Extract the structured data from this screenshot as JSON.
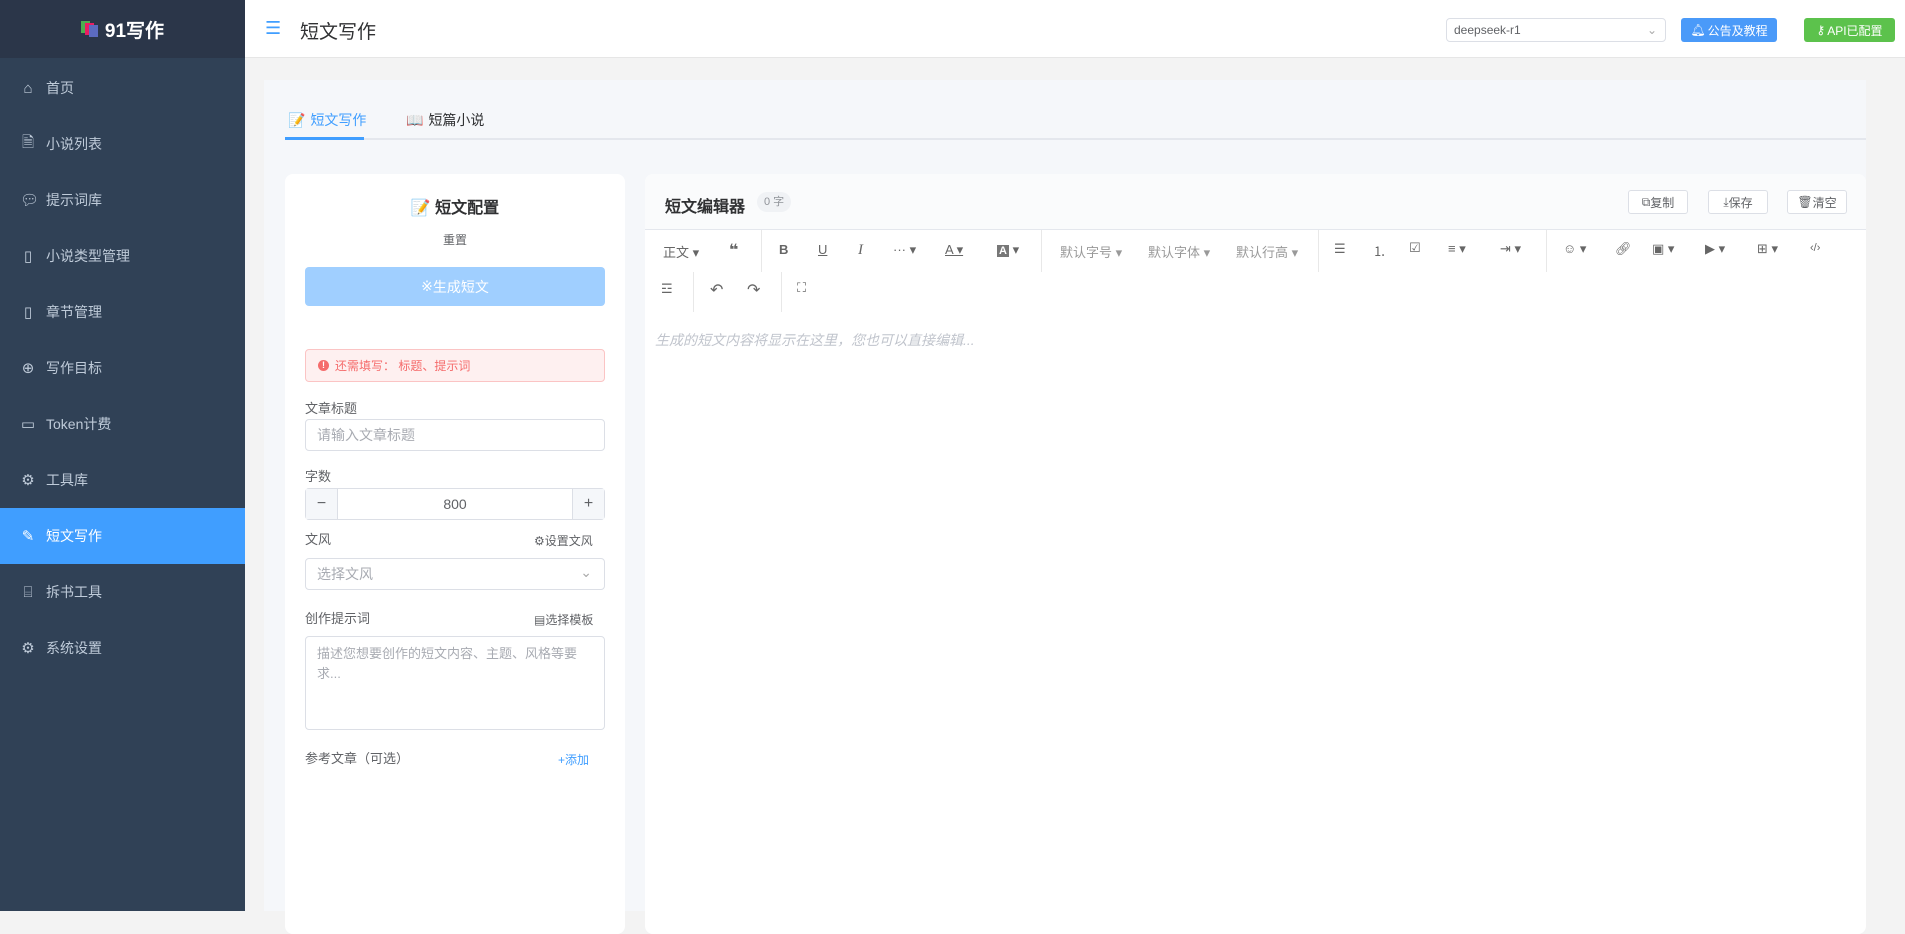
{
  "app": {
    "name": "91写作"
  },
  "sidebar": {
    "items": [
      {
        "label": "首页",
        "icon": "home-icon"
      },
      {
        "label": "小说列表",
        "icon": "document-icon"
      },
      {
        "label": "提示词库",
        "icon": "chat-icon"
      },
      {
        "label": "小说类型管理",
        "icon": "notebook-icon"
      },
      {
        "label": "章节管理",
        "icon": "book-icon"
      },
      {
        "label": "写作目标",
        "icon": "target-icon"
      },
      {
        "label": "Token计费",
        "icon": "card-icon"
      },
      {
        "label": "工具库",
        "icon": "gear-icon"
      },
      {
        "label": "短文写作",
        "icon": "pen-icon",
        "active": true
      },
      {
        "label": "拆书工具",
        "icon": "presentation-icon"
      },
      {
        "label": "系统设置",
        "icon": "settings-icon"
      }
    ]
  },
  "header": {
    "title": "短文写作",
    "model": "deepseek-r1",
    "notice_button": "公告及教程",
    "api_button": "API已配置",
    "accent": "#409eff",
    "success": "#67c23a"
  },
  "tabs": [
    {
      "label": "短文写作",
      "active": true
    },
    {
      "label": "短篇小说"
    }
  ],
  "config": {
    "title": "短文配置",
    "reset": "重置",
    "generate": "生成短文",
    "alert": "还需填写： 标题、提示词",
    "title_label": "文章标题",
    "title_placeholder": "请输入文章标题",
    "count_label": "字数",
    "count_value": "800",
    "style_label": "文风",
    "style_link": "设置文风",
    "style_placeholder": "选择文风",
    "prompt_label": "创作提示词",
    "prompt_link": "选择模板",
    "prompt_placeholder": "描述您想要创作的短文内容、主题、风格等要求...",
    "ref_label": "参考文章（可选）",
    "ref_add": "添加"
  },
  "editor": {
    "title": "短文编辑器",
    "count": "0 字",
    "copy": "复制",
    "save": "保存",
    "clear": "清空",
    "toolbar": {
      "paragraph": "正文",
      "font_size": "默认字号",
      "font_family": "默认字体",
      "line_height": "默认行高"
    },
    "placeholder": "生成的短文内容将显示在这里，您也可以直接编辑..."
  }
}
